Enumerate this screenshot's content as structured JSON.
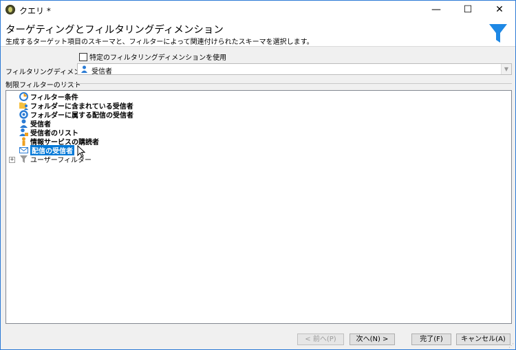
{
  "window": {
    "title": "クエリ *",
    "controls": {
      "minimize": "—",
      "maximize": "☐",
      "close": "✕"
    }
  },
  "header": {
    "title": "ターゲティングとフィルタリングディメンション",
    "subtitle": "生成するターゲット項目のスキーマと、フィルターによって関連付けられたスキーマを選択します。",
    "icon": "funnel-icon",
    "accent": "#1e88e5"
  },
  "options": {
    "specific_dimension_checkbox": {
      "label": "特定のフィルタリングディメンションを使用",
      "checked": false
    }
  },
  "filter_dimension": {
    "label": "フィルタリングディメンション:",
    "value": "受信者",
    "icon": "person-icon"
  },
  "restriction_list": {
    "label": "制限フィルターのリスト",
    "items": [
      {
        "label": "フィルター条件",
        "icon": "filter-condition-icon",
        "selected": false
      },
      {
        "label": "フォルダーに含まれている受信者",
        "icon": "folder-person-icon",
        "selected": false
      },
      {
        "label": "フォルダーに属する配信の受信者",
        "icon": "delivery-cycle-icon",
        "selected": false
      },
      {
        "label": "受信者",
        "icon": "person-icon",
        "selected": false
      },
      {
        "label": "受信者のリスト",
        "icon": "person-list-icon",
        "selected": false
      },
      {
        "label": "情報サービスの購読者",
        "icon": "subscriber-icon",
        "selected": false
      },
      {
        "label": "配信の受信者",
        "icon": "envelope-icon",
        "selected": true
      },
      {
        "label": "ユーザーフィルター",
        "icon": "funnel-icon",
        "selected": false,
        "expandable": true
      }
    ]
  },
  "buttons": {
    "prev": "< 前へ(P)",
    "next": "次へ(N) >",
    "finish": "完了(F)",
    "cancel": "キャンセル(A)"
  }
}
